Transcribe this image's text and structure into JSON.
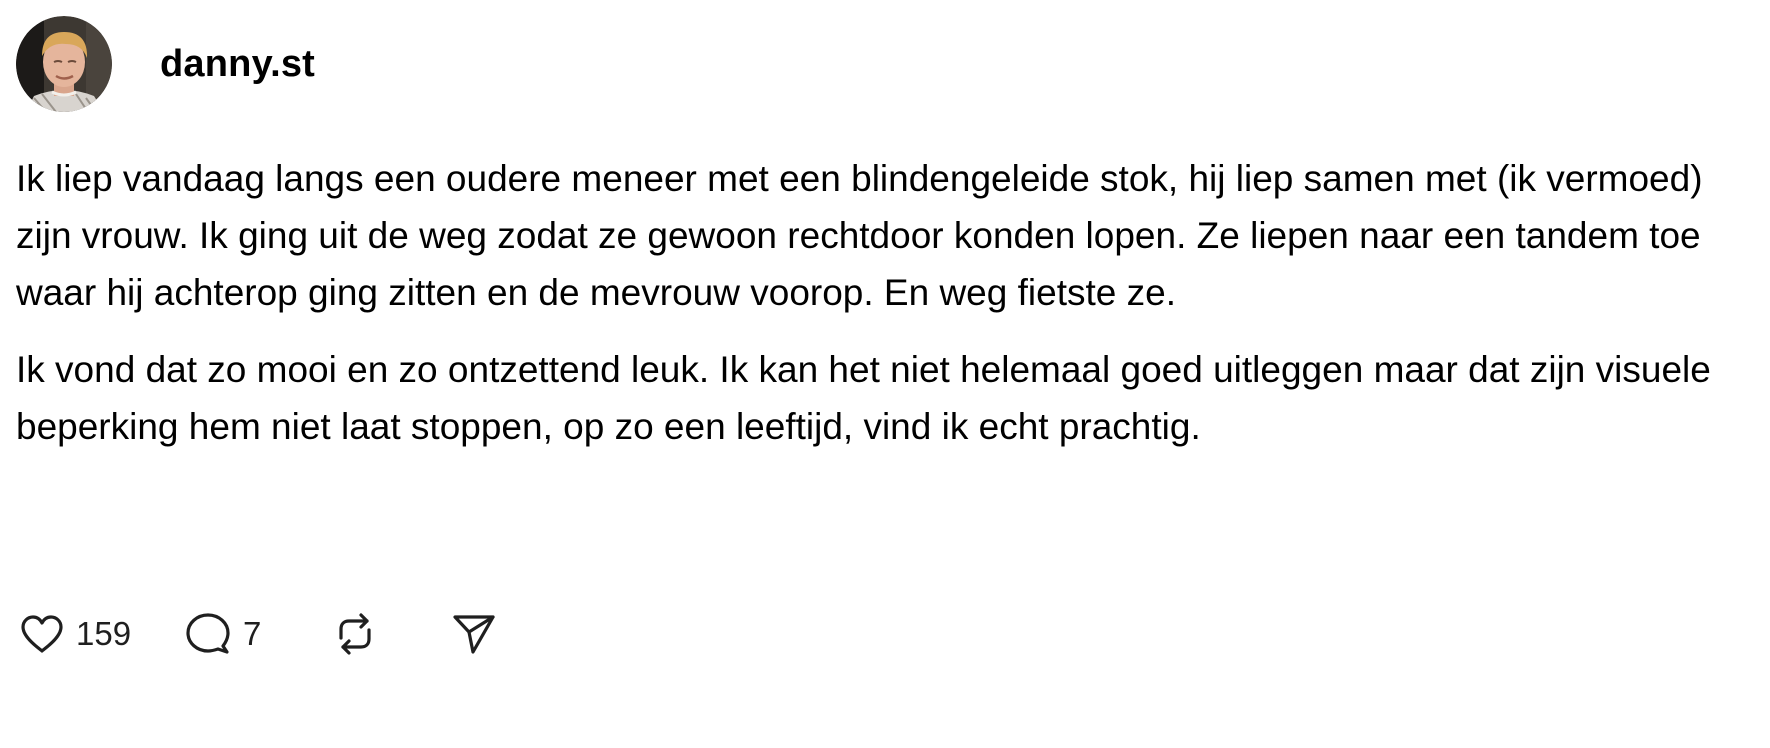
{
  "post": {
    "username": "danny.st",
    "avatar_icon": "profile-photo",
    "paragraphs": [
      "Ik liep vandaag langs een oudere meneer met een blindengeleide stok, hij liep samen met (ik vermoed) zijn vrouw. Ik ging uit de weg zodat ze gewoon rechtdoor konden lopen. Ze liepen naar een tandem toe waar hij achterop ging zitten en de mevrouw voorop. En weg fietste ze.",
      "Ik vond dat zo mooi en zo ontzettend leuk. Ik kan het niet helemaal goed uitleggen maar dat zijn visuele beperking hem niet laat stoppen, op zo een leeftijd, vind ik echt prachtig."
    ]
  },
  "actions": {
    "like": {
      "icon": "heart-icon",
      "count": "159"
    },
    "reply": {
      "icon": "comment-icon",
      "count": "7"
    },
    "repost": {
      "icon": "repost-icon"
    },
    "share": {
      "icon": "send-icon"
    }
  },
  "colors": {
    "text": "#000000",
    "icon_stroke": "#1f1f1f",
    "background": "#ffffff"
  }
}
